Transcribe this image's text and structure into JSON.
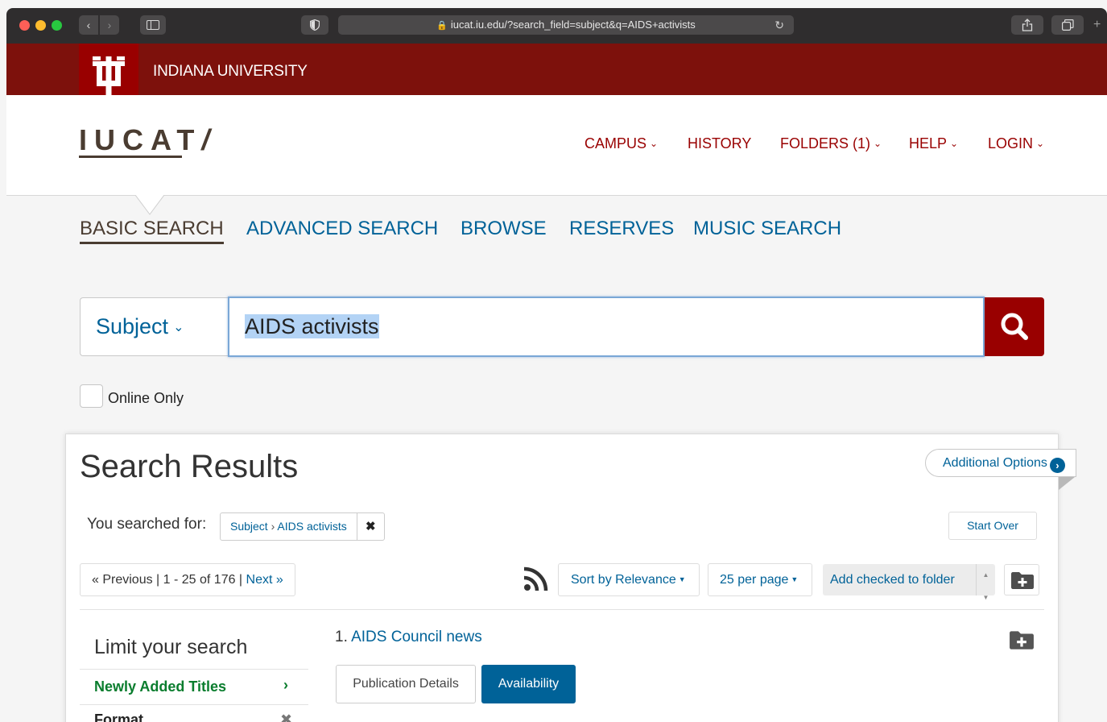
{
  "browser": {
    "url": "iucat.iu.edu/?search_field=subject&q=AIDS+activists",
    "back_glyph": "‹",
    "forward_glyph": "›",
    "reload_glyph": "↻",
    "plus_glyph": "+"
  },
  "brand": {
    "university": "INDIANA UNIVERSITY",
    "logo_text": "IUCAT",
    "logo_slash": "/",
    "primary_color": "#990000",
    "accent_color": "#006298"
  },
  "top_nav": [
    {
      "label": "CAMPUS",
      "dropdown": true
    },
    {
      "label": "HISTORY",
      "dropdown": false
    },
    {
      "label": "FOLDERS (1)",
      "dropdown": true
    },
    {
      "label": "HELP",
      "dropdown": true
    },
    {
      "label": "LOGIN",
      "dropdown": true
    }
  ],
  "search_tabs": [
    "BASIC SEARCH",
    "ADVANCED SEARCH",
    "BROWSE",
    "RESERVES",
    "MUSIC SEARCH"
  ],
  "search": {
    "field": "Subject",
    "query": "AIDS activists",
    "online_only_label": "Online Only",
    "online_only_checked": false
  },
  "results": {
    "heading": "Search Results",
    "additional_options": "Additional Options",
    "searched_for_label": "You searched for:",
    "constraint_field": "Subject",
    "constraint_sep": "›",
    "constraint_value": "AIDS activists",
    "start_over": "Start Over",
    "pager": {
      "previous": "« Previous",
      "range": "1 - 25 of 176",
      "next": "Next »"
    },
    "sort_label": "Sort by Relevance",
    "per_page_label": "25 per page",
    "folder_action": "Add checked to folder"
  },
  "facets": {
    "heading": "Limit your search",
    "items": [
      {
        "label": "Newly Added Titles",
        "glyph": "›"
      },
      {
        "label": "Format",
        "glyph": "✖"
      }
    ]
  },
  "items": [
    {
      "number": "1.",
      "title": "AIDS Council news",
      "tabs": [
        "Publication Details",
        "Availability"
      ]
    }
  ]
}
